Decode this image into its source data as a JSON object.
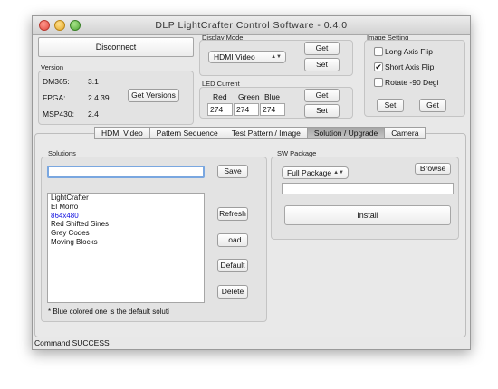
{
  "window": {
    "title": "DLP LightCrafter Control Software - 0.4.0"
  },
  "connection": {
    "disconnect_label": "Disconnect"
  },
  "version": {
    "title": "Version",
    "rows": [
      {
        "label": "DM365:",
        "value": "3.1"
      },
      {
        "label": "FPGA:",
        "value": "2.4.39"
      },
      {
        "label": "MSP430:",
        "value": "2.4"
      }
    ],
    "get_versions_label": "Get Versions"
  },
  "display_mode": {
    "title": "Display Mode",
    "selected": "HDMI Video",
    "get_label": "Get",
    "set_label": "Set"
  },
  "led_current": {
    "title": "LED Current",
    "red_label": "Red",
    "green_label": "Green",
    "blue_label": "Blue",
    "red_value": "274",
    "green_value": "274",
    "blue_value": "274",
    "get_label": "Get",
    "set_label": "Set"
  },
  "image_setting": {
    "title": "Image Setting",
    "long_axis_flip": {
      "label": "Long Axis Flip",
      "checked": false
    },
    "short_axis_flip": {
      "label": "Short Axis Flip",
      "checked": true
    },
    "rotate": {
      "label": "Rotate -90 Degi",
      "checked": false
    },
    "set_label": "Set",
    "get_label": "Get"
  },
  "tabs": [
    {
      "label": "HDMI Video",
      "selected": false
    },
    {
      "label": "Pattern Sequence",
      "selected": false
    },
    {
      "label": "Test Pattern / Image",
      "selected": false
    },
    {
      "label": "Solution / Upgrade",
      "selected": true
    },
    {
      "label": "Camera",
      "selected": false
    }
  ],
  "solutions": {
    "title": "Solutions",
    "name_value": "",
    "save_label": "Save",
    "items": [
      {
        "label": "LightCrafter",
        "is_default": false
      },
      {
        "label": "El Morro",
        "is_default": false
      },
      {
        "label": "864x480",
        "is_default": true
      },
      {
        "label": "Red Shifted Sines",
        "is_default": false
      },
      {
        "label": "Grey Codes",
        "is_default": false
      },
      {
        "label": "Moving Blocks",
        "is_default": false
      }
    ],
    "refresh_label": "Refresh",
    "load_label": "Load",
    "default_label": "Default",
    "delete_label": "Delete",
    "note": "* Blue colored one is the default soluti",
    "default_color": "#1414e0"
  },
  "sw_package": {
    "title": "SW Package",
    "selected": "Full Package",
    "browse_label": "Browse",
    "path_value": "",
    "install_label": "Install"
  },
  "status": {
    "text": "Command SUCCESS"
  }
}
